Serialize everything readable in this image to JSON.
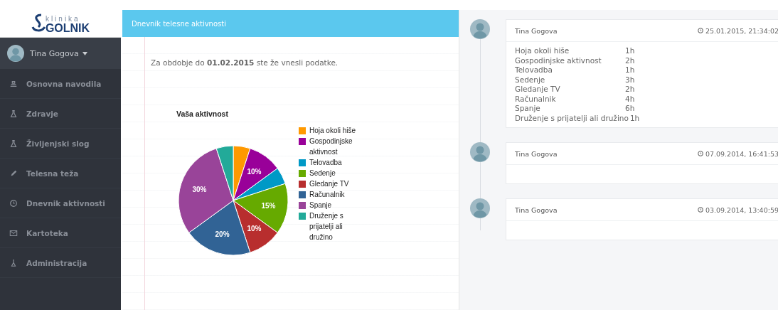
{
  "logo": {
    "small": "klinika",
    "big": "GOLNIK"
  },
  "user": {
    "name": "Tina Gogova"
  },
  "sidebar": {
    "items": [
      {
        "label": "Osnovna navodila",
        "selected": false
      },
      {
        "label": "Zdravje",
        "selected": false
      },
      {
        "label": "Življenjski slog",
        "selected": false
      },
      {
        "label": "Telesna teža",
        "selected": false
      },
      {
        "label": "Dnevnik aktivnosti",
        "selected": false
      },
      {
        "label": "Kartoteka",
        "selected": false
      },
      {
        "label": "Administracija",
        "selected": false
      }
    ]
  },
  "panel": {
    "title": "Dnevnik telesne aktivnosti",
    "notice": "Za obdobje do **01.02.2015** ste že vnesli podatke.",
    "chart_data": {
      "type": "pie",
      "title": "Vaša aktivnost",
      "categories": [
        "Hoja okoli hiše",
        "Gospodinjske aktivnost",
        "Telovadba",
        "Sedenje",
        "Gledanje TV",
        "Računalnik",
        "Spanje",
        "Druženje s prijatelji ali družino"
      ],
      "values": [
        5,
        10,
        5,
        15,
        10,
        20,
        30,
        5
      ],
      "legend": "right",
      "colors": [
        "#ff9900",
        "#990099",
        "#0099c6",
        "#66aa00",
        "#b82e2e",
        "#316395",
        "#994499",
        "#22aa99"
      ],
      "value_labels": [
        null,
        "10%",
        null,
        "15%",
        "10%",
        "20%",
        "30%",
        null
      ]
    }
  },
  "timeline": [
    {
      "author": "Tina Gogova",
      "time": "25.01.2015, 21:34:02",
      "rows": [
        {
          "activity": "Hoja okoli hiše",
          "hours": "1h"
        },
        {
          "activity": "Gospodinjske aktivnost",
          "hours": "2h"
        },
        {
          "activity": "Telovadba",
          "hours": "1h"
        },
        {
          "activity": "Sedenje",
          "hours": "3h"
        },
        {
          "activity": "Gledanje TV",
          "hours": "2h"
        },
        {
          "activity": "Računalnik",
          "hours": "4h"
        },
        {
          "activity": "Spanje",
          "hours": "6h"
        },
        {
          "activity": "Druženje s prijatelji ali družino",
          "hours": "1h"
        }
      ]
    },
    {
      "author": "Tina Gogova",
      "time": "07.09.2014, 16:41:53"
    },
    {
      "author": "Tina Gogova",
      "time": "03.09.2014, 13:40:59"
    }
  ]
}
